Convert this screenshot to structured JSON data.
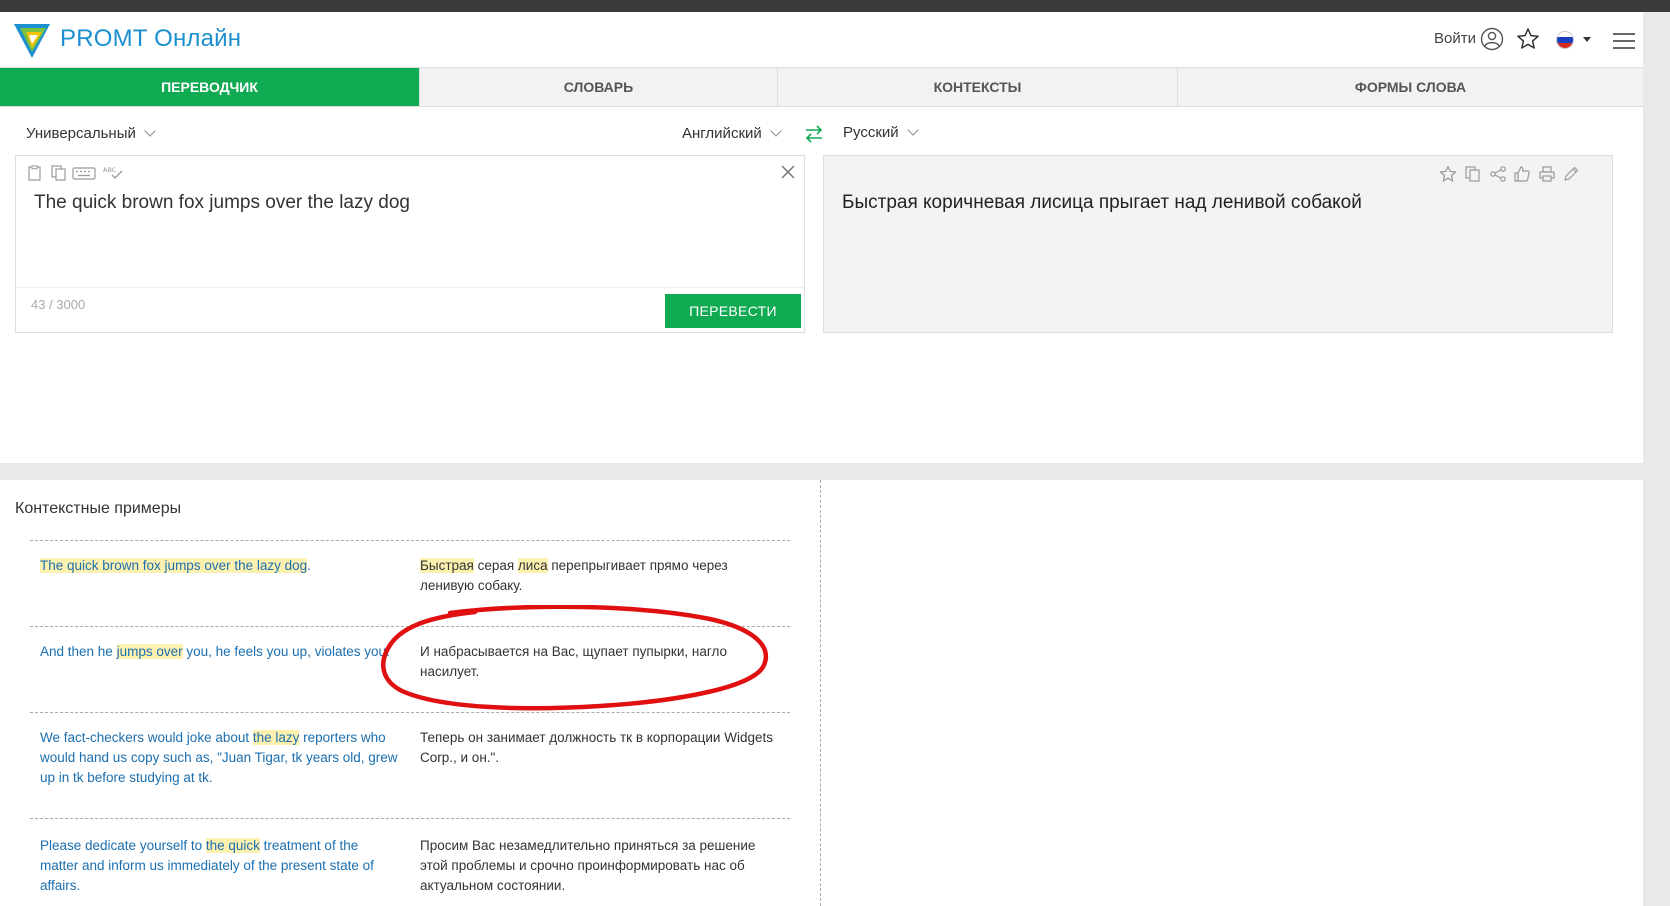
{
  "header": {
    "brand": "PROMT Онлайн",
    "login": "Войти"
  },
  "tabs": [
    {
      "label": "ПЕРЕВОДЧИК",
      "active": true
    },
    {
      "label": "СЛОВАРЬ",
      "active": false
    },
    {
      "label": "КОНТЕКСТЫ",
      "active": false
    },
    {
      "label": "ФОРМЫ СЛОВА",
      "active": false
    }
  ],
  "langbar": {
    "topic": "Универсальный",
    "source_lang": "Английский",
    "target_lang": "Русский"
  },
  "source": {
    "text": "The quick brown fox jumps over the lazy dog",
    "counter": "43 / 3000",
    "translate_button": "ПЕРЕВЕСТИ",
    "spell_label": "ABC"
  },
  "target": {
    "text": "Быстрая коричневая лисица прыгает над ленивой собакой"
  },
  "context": {
    "title": "Контекстные примеры",
    "rows": [
      {
        "en": [
          {
            "t": "The quick brown fox jumps over the lazy dog",
            "h": true
          },
          {
            "t": ".",
            "h": false
          }
        ],
        "ru": [
          {
            "t": "Быстрая",
            "h": true
          },
          {
            "t": " серая ",
            "h": false
          },
          {
            "t": "лиса",
            "h": true
          },
          {
            "t": " перепрыгивает прямо через ленивую собаку.",
            "h": false
          }
        ]
      },
      {
        "en": [
          {
            "t": "And then he ",
            "h": false
          },
          {
            "t": "jumps over",
            "h": true
          },
          {
            "t": " you, he feels you up, violates you.",
            "h": false
          }
        ],
        "ru": [
          {
            "t": "И набрасывается на Вас, щупает пупырки, нагло насилует.",
            "h": false
          }
        ]
      },
      {
        "en": [
          {
            "t": "We fact-checkers would joke about ",
            "h": false
          },
          {
            "t": "the lazy",
            "h": true
          },
          {
            "t": " reporters who would hand us copy such as, \"Juan Tigar, tk years old, grew up in tk before studying at tk.",
            "h": false
          }
        ],
        "ru": [
          {
            "t": "Теперь он занимает должность тк в корпорации Widgets Corp., и он.\".",
            "h": false
          }
        ]
      },
      {
        "en": [
          {
            "t": "Please dedicate yourself to ",
            "h": false
          },
          {
            "t": "the quick",
            "h": true
          },
          {
            "t": " treatment of the matter and inform us immediately of the present state of affairs.",
            "h": false
          }
        ],
        "ru": [
          {
            "t": "Просим Вас незамедлительно приняться за решение этой проблемы и срочно проинформировать нас об актуальном состоянии.",
            "h": false
          }
        ]
      }
    ]
  },
  "colors": {
    "accent_green": "#0faa52",
    "brand_blue": "#1b8fd0",
    "highlight": "#fdf1b0",
    "annotation_red": "#e01010"
  }
}
